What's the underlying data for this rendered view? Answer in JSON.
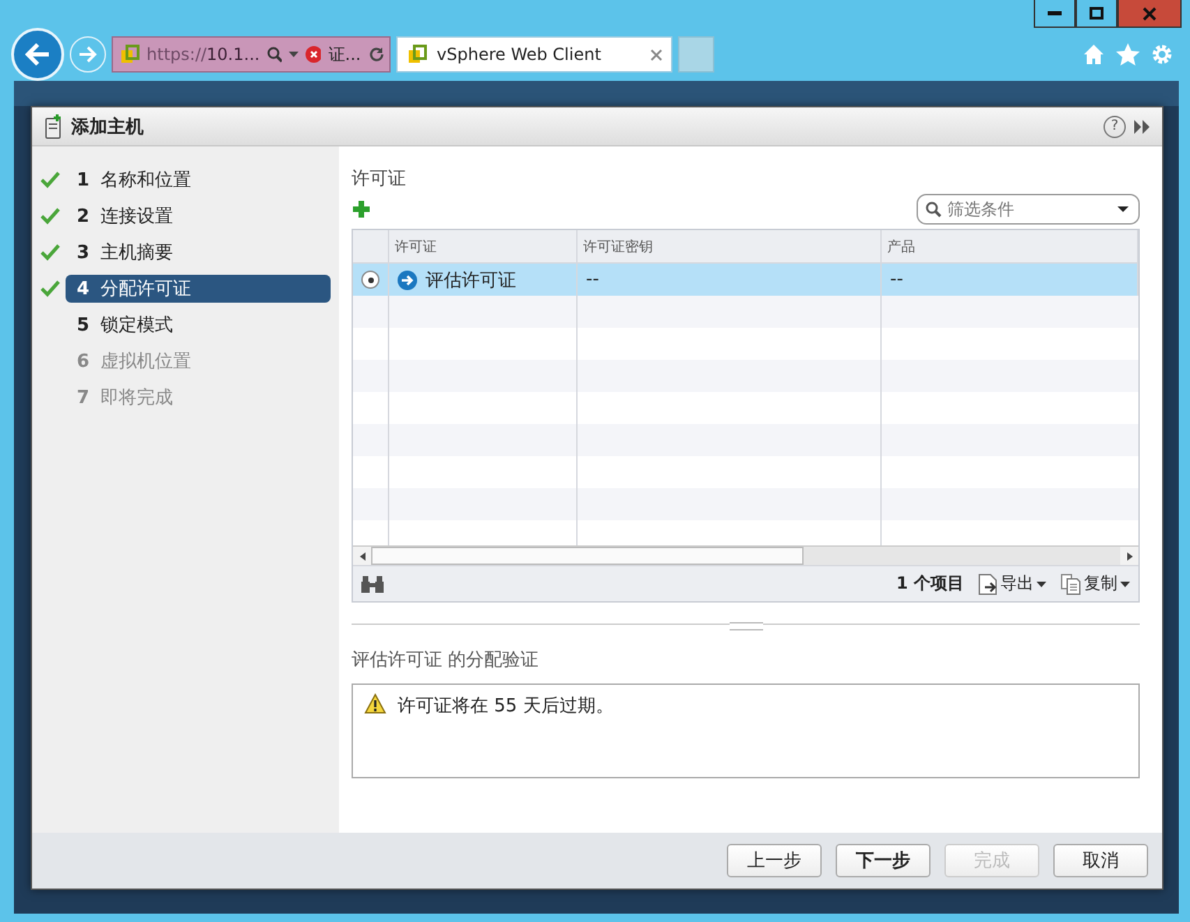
{
  "browser": {
    "address_scheme": "https://",
    "address_host": "10.1...",
    "cert_label": "证...",
    "tabs": [
      {
        "title": "vSphere Web Client",
        "selected": true
      }
    ]
  },
  "dialog": {
    "title": "添加主机",
    "help_glyph": "?",
    "steps": [
      {
        "number": "1",
        "label": "名称和位置",
        "done": true,
        "selected": false,
        "disabled": false
      },
      {
        "number": "2",
        "label": "连接设置",
        "done": true,
        "selected": false,
        "disabled": false
      },
      {
        "number": "3",
        "label": "主机摘要",
        "done": true,
        "selected": false,
        "disabled": false
      },
      {
        "number": "4",
        "label": "分配许可证",
        "done": true,
        "selected": true,
        "disabled": false
      },
      {
        "number": "5",
        "label": "锁定模式",
        "done": false,
        "selected": false,
        "disabled": false
      },
      {
        "number": "6",
        "label": "虚拟机位置",
        "done": false,
        "selected": false,
        "disabled": true
      },
      {
        "number": "7",
        "label": "即将完成",
        "done": false,
        "selected": false,
        "disabled": true
      }
    ],
    "section_title": "许可证",
    "filter": {
      "placeholder": "筛选条件"
    },
    "table": {
      "columns": [
        "许可证",
        "许可证密钥",
        "产品"
      ],
      "rows": [
        {
          "selected": true,
          "cells": [
            "评估许可证",
            "--",
            "--"
          ]
        }
      ]
    },
    "count": "1 个项目",
    "export": "导出",
    "copy": "复制",
    "validation_title": "评估许可证 的分配验证",
    "message": "许可证将在 55 天后过期。",
    "buttons": [
      {
        "label": "上一步",
        "primary": false,
        "disabled": false
      },
      {
        "label": "下一步",
        "primary": true,
        "disabled": false
      },
      {
        "label": "完成",
        "primary": false,
        "disabled": true
      },
      {
        "label": "取消",
        "primary": false,
        "disabled": false
      }
    ]
  }
}
